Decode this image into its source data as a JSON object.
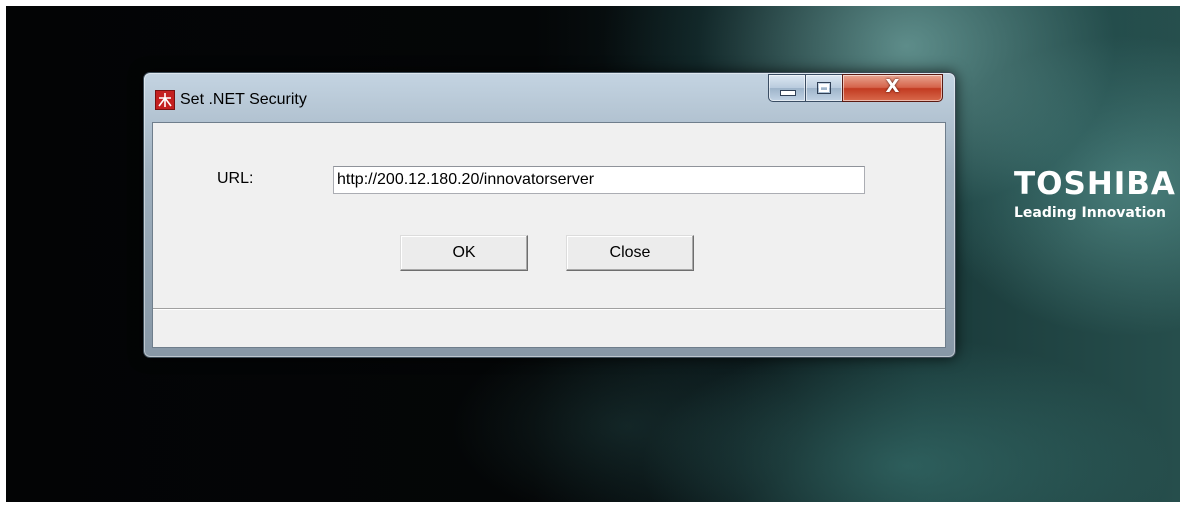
{
  "desktop": {
    "brand_name": "TOSHIBA",
    "brand_slogan": "Leading Innovation"
  },
  "window": {
    "title": "Set .NET Security",
    "app_icon": "app-logo-icon",
    "caption": {
      "minimize_icon": "minimize-icon",
      "maximize_icon": "maximize-icon",
      "close_glyph": "X"
    }
  },
  "form": {
    "url_label": "URL:",
    "url_value": "http://200.12.180.20/innovatorserver",
    "ok_label": "OK",
    "close_label": "Close"
  },
  "status_bar": {
    "text": ""
  }
}
